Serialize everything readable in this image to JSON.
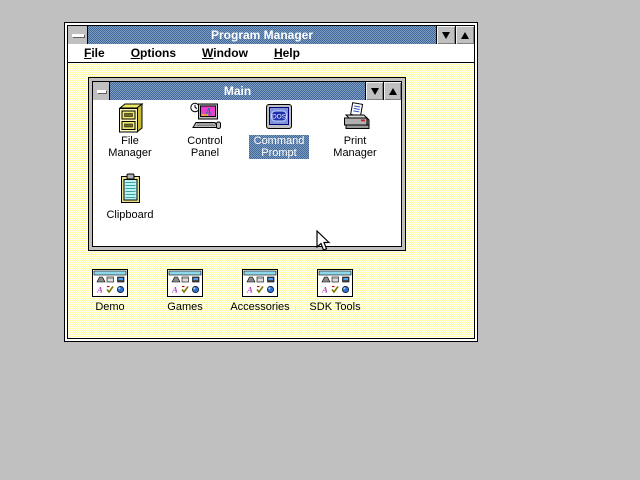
{
  "program_manager": {
    "title": "Program Manager",
    "menu_items": [
      {
        "label": "File"
      },
      {
        "label": "Options"
      },
      {
        "label": "Window"
      },
      {
        "label": "Help"
      }
    ]
  },
  "main_group_window": {
    "title": "Main",
    "items": [
      {
        "label": "File Manager",
        "icon": "file-cabinet-icon",
        "selected": false
      },
      {
        "label": "Control Panel",
        "icon": "control-panel-icon",
        "selected": false
      },
      {
        "label": "Command Prompt",
        "icon": "dos-monitor-icon",
        "screen_text": "DOS",
        "selected": true
      },
      {
        "label": "Print Manager",
        "icon": "printer-icon",
        "selected": false
      },
      {
        "label": "Clipboard",
        "icon": "clipboard-icon",
        "selected": false
      }
    ]
  },
  "program_groups": [
    {
      "label": "Demo",
      "icon": "program-group-icon"
    },
    {
      "label": "Games",
      "icon": "program-group-icon"
    },
    {
      "label": "Accessories",
      "icon": "program-group-icon"
    },
    {
      "label": "SDK Tools",
      "icon": "program-group-icon"
    }
  ],
  "colors": {
    "desktop": "#c0c0c0",
    "titlebar_dither_light": "#7e9cbf",
    "titlebar_dither_dark": "#40689a",
    "client_dither_yellow": "#ffffa0",
    "window_chrome": "#c0c0c0",
    "selection_text": "#ffffff"
  }
}
